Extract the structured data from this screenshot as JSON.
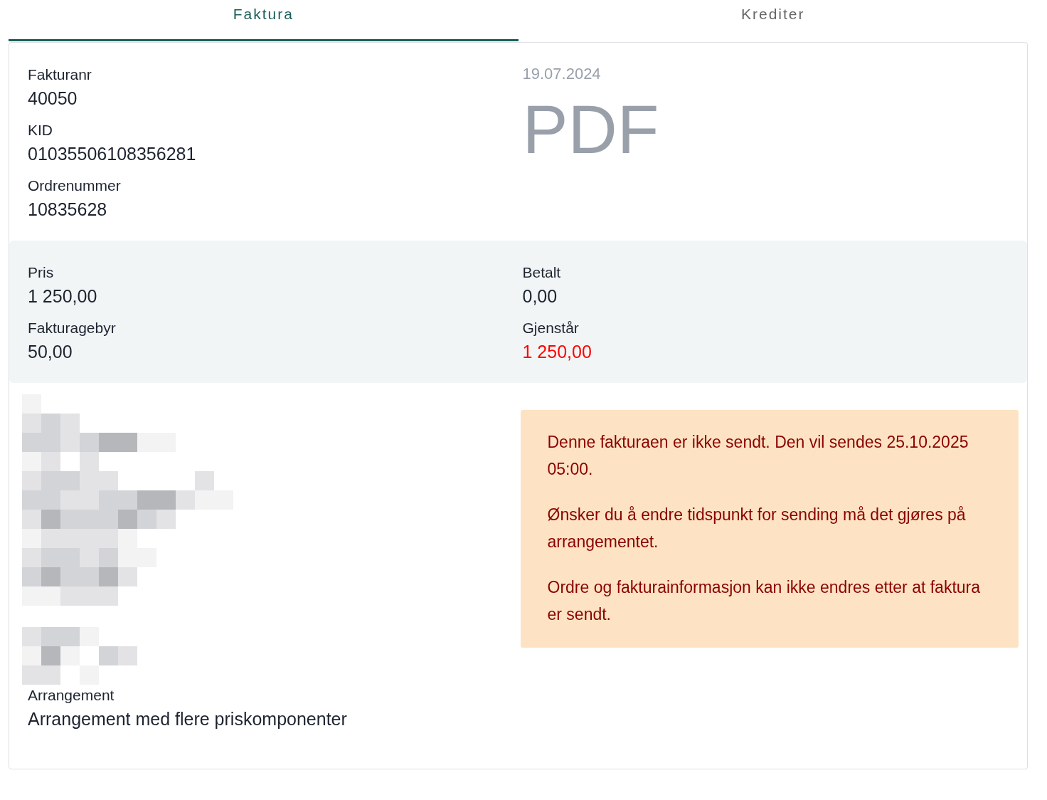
{
  "tabs": [
    {
      "label": "Faktura",
      "selected": true
    },
    {
      "label": "Krediter",
      "selected": false
    }
  ],
  "invoice": {
    "fields": [
      {
        "label": "Fakturanr",
        "value": "40050"
      },
      {
        "label": "KID",
        "value": "01035506108356281"
      },
      {
        "label": "Ordrenummer",
        "value": "10835628"
      }
    ],
    "date": "19.07.2024",
    "document": "PDF"
  },
  "amounts": {
    "columns": [
      [
        {
          "label": "Pris",
          "value": "1 250,00",
          "alert": false
        },
        {
          "label": "Fakturagebyr",
          "value": "50,00",
          "alert": false
        }
      ],
      [
        {
          "label": "Betalt",
          "value": "0,00",
          "alert": false
        },
        {
          "label": "Gjenstår",
          "value": "1 250,00",
          "alert": true
        }
      ]
    ]
  },
  "event": {
    "label": "Arrangement",
    "value": "Arrangement med flere priskomponenter"
  },
  "notice": [
    "Denne fakturaen er ikke sendt. Den vil sendes 25.10.2025 05:00.",
    "Ønsker du å endre tidspunkt for sending må det gjøres på arrangementet.",
    "Ordre og fakturainformasjon kan ikke endres etter at faktura er sendt."
  ]
}
